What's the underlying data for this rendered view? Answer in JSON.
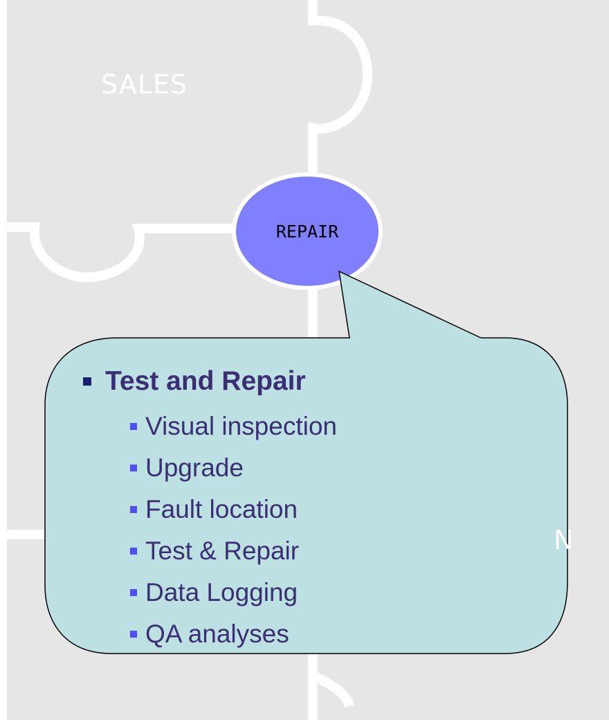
{
  "pieces": {
    "top_left": "SALES",
    "bottom_right_partial": "N"
  },
  "center_node": "REPAIR",
  "callout": {
    "heading": "Test and Repair",
    "items": [
      "Visual inspection",
      "Upgrade",
      "Fault location",
      "Test & Repair",
      "Data Logging",
      "QA analyses"
    ]
  },
  "colors": {
    "piece_fill": "#e6e6e6",
    "piece_border": "#ffffff",
    "ellipse_fill": "#8080ff",
    "callout_fill": "#bde0e3",
    "text": "#3a2f72",
    "main_bullet": "#1a1f73",
    "sub_bullet": "#4e4ff6"
  }
}
